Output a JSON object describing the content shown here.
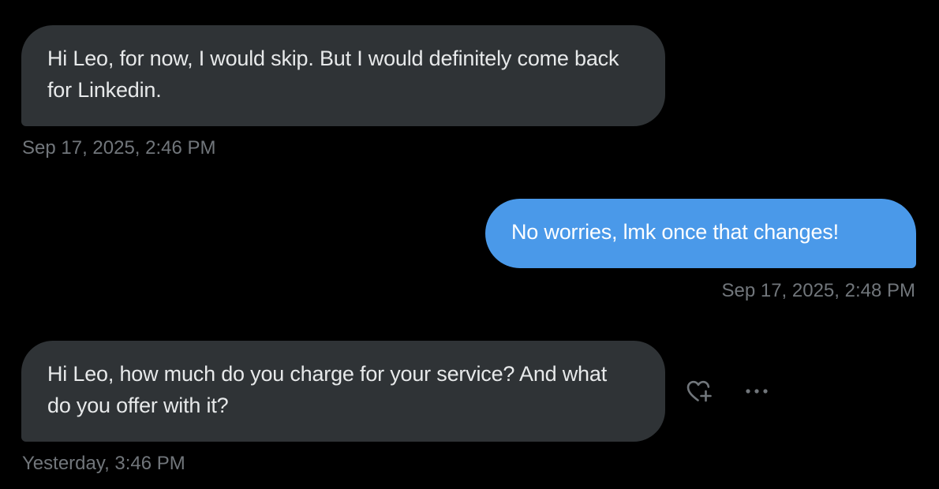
{
  "conversation": {
    "messages": [
      {
        "direction": "received",
        "text": "Hi Leo, for now, I would skip. But I would definitely come back for Linkedin.",
        "timestamp": "Sep 17, 2025, 2:46 PM"
      },
      {
        "direction": "sent",
        "text": "No worries, lmk once that changes!",
        "timestamp": "Sep 17, 2025, 2:48 PM"
      },
      {
        "direction": "received",
        "text": "Hi Leo, how much do you charge for your service? And what do you offer with it?",
        "timestamp": "Yesterday, 3:46 PM"
      }
    ],
    "hover_actions": {
      "react_icon": "heart-plus-icon",
      "more_icon": "more-horizontal-icon"
    }
  },
  "colors": {
    "background": "#000000",
    "received_bubble": "#2f3336",
    "sent_bubble": "#4a99e9",
    "text_primary": "#e7e9ea",
    "timestamp": "#71767b"
  }
}
